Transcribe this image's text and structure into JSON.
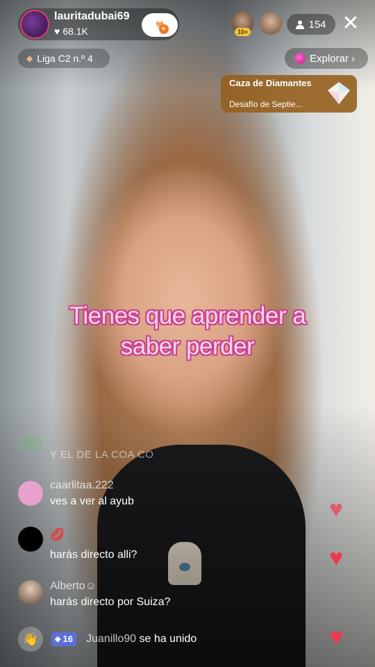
{
  "host": {
    "username": "lauritadubai69",
    "likes": "68.1K",
    "follow_icon": "heart-plus-icon"
  },
  "top_bar": {
    "viewer_badge": "10+",
    "viewer_count": "154",
    "close_icon": "close-icon"
  },
  "league": {
    "label": "Liga C2 n.º 4"
  },
  "explore": {
    "label": "Explorar ›"
  },
  "event": {
    "title": "Caza de Diamantes",
    "subtitle": "Desafío de Septie..."
  },
  "caption": "Tienes que aprender a saber perder",
  "comments": [
    {
      "name": "",
      "text": "Y EL DE LA COA CO",
      "avatar_color": "#3e6a42"
    },
    {
      "name": "caarlitaa.222",
      "text": "ves a ver al ayub",
      "avatar_color": "#e9a1cd"
    },
    {
      "name": "💋",
      "text": "harás directo alli?",
      "avatar_color": "#000000"
    },
    {
      "name": "Alberto☺",
      "text": "harás directo por Suiza?",
      "avatar_color": "#c9b4a4"
    }
  ],
  "join": {
    "badge": "16",
    "user": "Juanillo90",
    "text": " se ha unido",
    "icon": "wave-hand-icon"
  },
  "colors": {
    "heart": "#f0384f",
    "caption_fill": "#fbd3ec",
    "caption_stroke": "#c9458d"
  }
}
